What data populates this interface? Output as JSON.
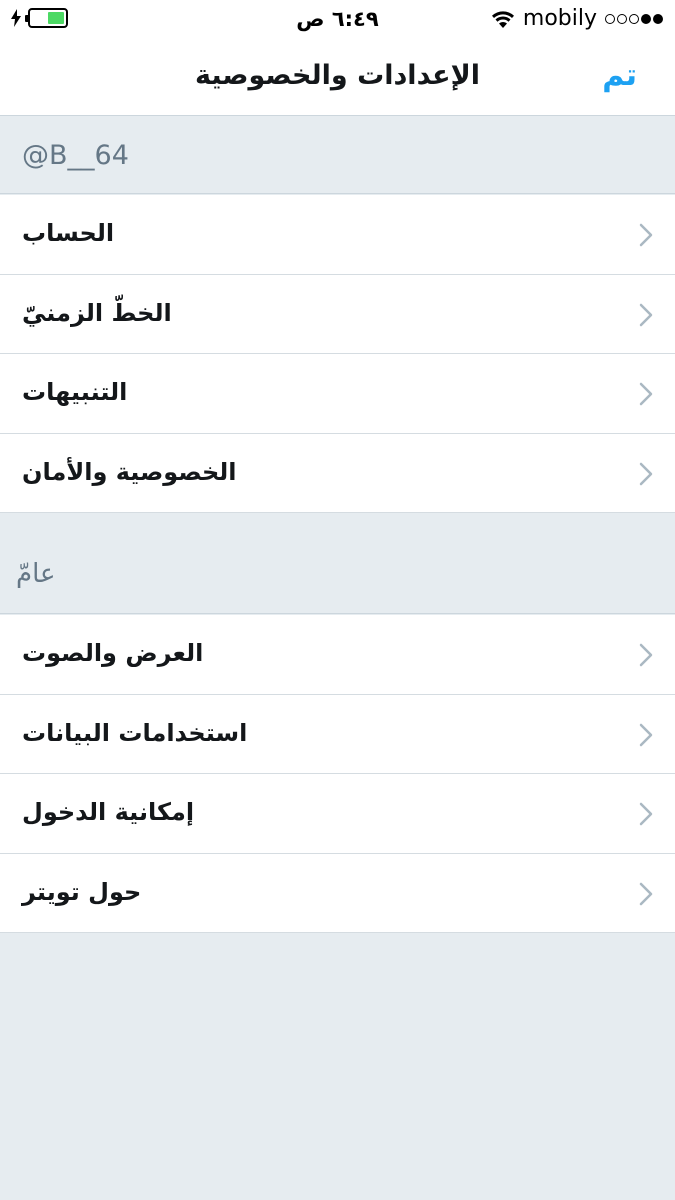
{
  "status_bar": {
    "time": "٦:٤٩ ص",
    "carrier": "mobily",
    "battery_level": 0.5,
    "signal_bars_on": 2,
    "signal_bars_total": 5,
    "battery_color": "#4cd964"
  },
  "nav": {
    "title": "الإعدادات والخصوصية",
    "done_label": "تم",
    "accent_color": "#1da1f2"
  },
  "account_section": {
    "handle": "@B__64",
    "items": [
      {
        "label": "الحساب",
        "icon": "chevron-right-icon"
      },
      {
        "label": "الخطّ الزمنيّ",
        "icon": "chevron-right-icon"
      },
      {
        "label": "التنبيهات",
        "icon": "chevron-right-icon"
      },
      {
        "label": "الخصوصية والأمان",
        "icon": "chevron-right-icon"
      }
    ]
  },
  "general_section": {
    "header": "عامّ",
    "items": [
      {
        "label": "العرض والصوت",
        "icon": "chevron-right-icon"
      },
      {
        "label": "استخدامات البيانات",
        "icon": "chevron-right-icon"
      },
      {
        "label": "إمكانية الدخول",
        "icon": "chevron-right-icon"
      },
      {
        "label": "حول تويتر",
        "icon": "chevron-right-icon"
      }
    ]
  }
}
